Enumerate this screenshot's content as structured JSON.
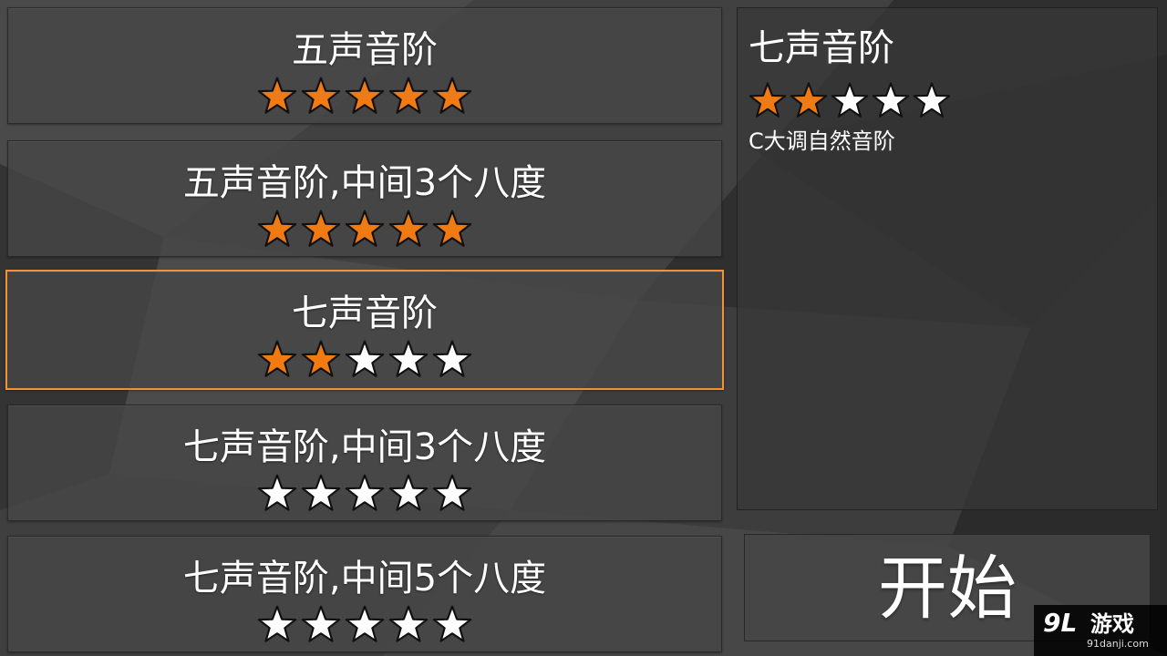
{
  "colors": {
    "accent": "#f0923a",
    "star_filled": "#f27a12",
    "star_empty": "#ffffff",
    "panel": "#464646"
  },
  "levels": [
    {
      "title": "五声音阶",
      "rating": 5,
      "max_rating": 5,
      "selected": false
    },
    {
      "title": "五声音阶,中间3个八度",
      "rating": 5,
      "max_rating": 5,
      "selected": false
    },
    {
      "title": "七声音阶",
      "rating": 2,
      "max_rating": 5,
      "selected": true
    },
    {
      "title": "七声音阶,中间3个八度",
      "rating": 0,
      "max_rating": 5,
      "selected": false
    },
    {
      "title": "七声音阶,中间5个八度",
      "rating": 0,
      "max_rating": 5,
      "selected": false
    }
  ],
  "detail": {
    "title": "七声音阶",
    "rating": 2,
    "max_rating": 5,
    "description": "C大调自然音阶"
  },
  "start_button": {
    "label": "开始"
  },
  "watermark": {
    "mark": "9L",
    "name": "游戏",
    "site": "91danji.com"
  }
}
